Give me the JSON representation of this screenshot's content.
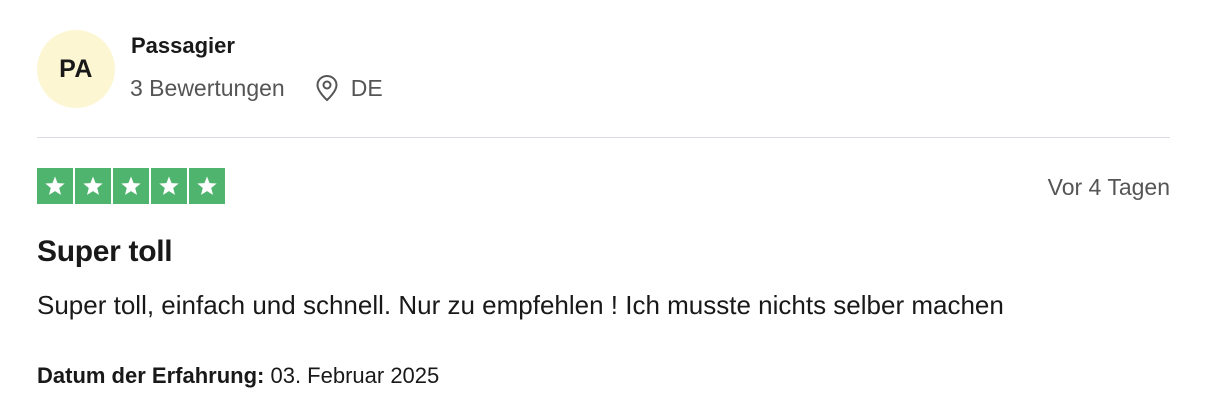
{
  "reviewer": {
    "initials": "PA",
    "name": "Passagier",
    "review_count": "3 Bewertungen",
    "country": "DE",
    "location_icon": "location-pin-icon"
  },
  "review": {
    "rating": 5,
    "rating_max": 5,
    "star_color": "#4fb46d",
    "relative_date": "Vor 4 Tagen",
    "title": "Super toll",
    "body": "Super toll, einfach und schnell. Nur zu empfehlen ! Ich musste nichts selber machen",
    "experience_label": "Datum der Erfahrung:",
    "experience_date": "03. Februar 2025"
  },
  "colors": {
    "avatar_bg": "#fcf6d2",
    "muted_text": "#555555",
    "divider": "#dcdce6"
  }
}
